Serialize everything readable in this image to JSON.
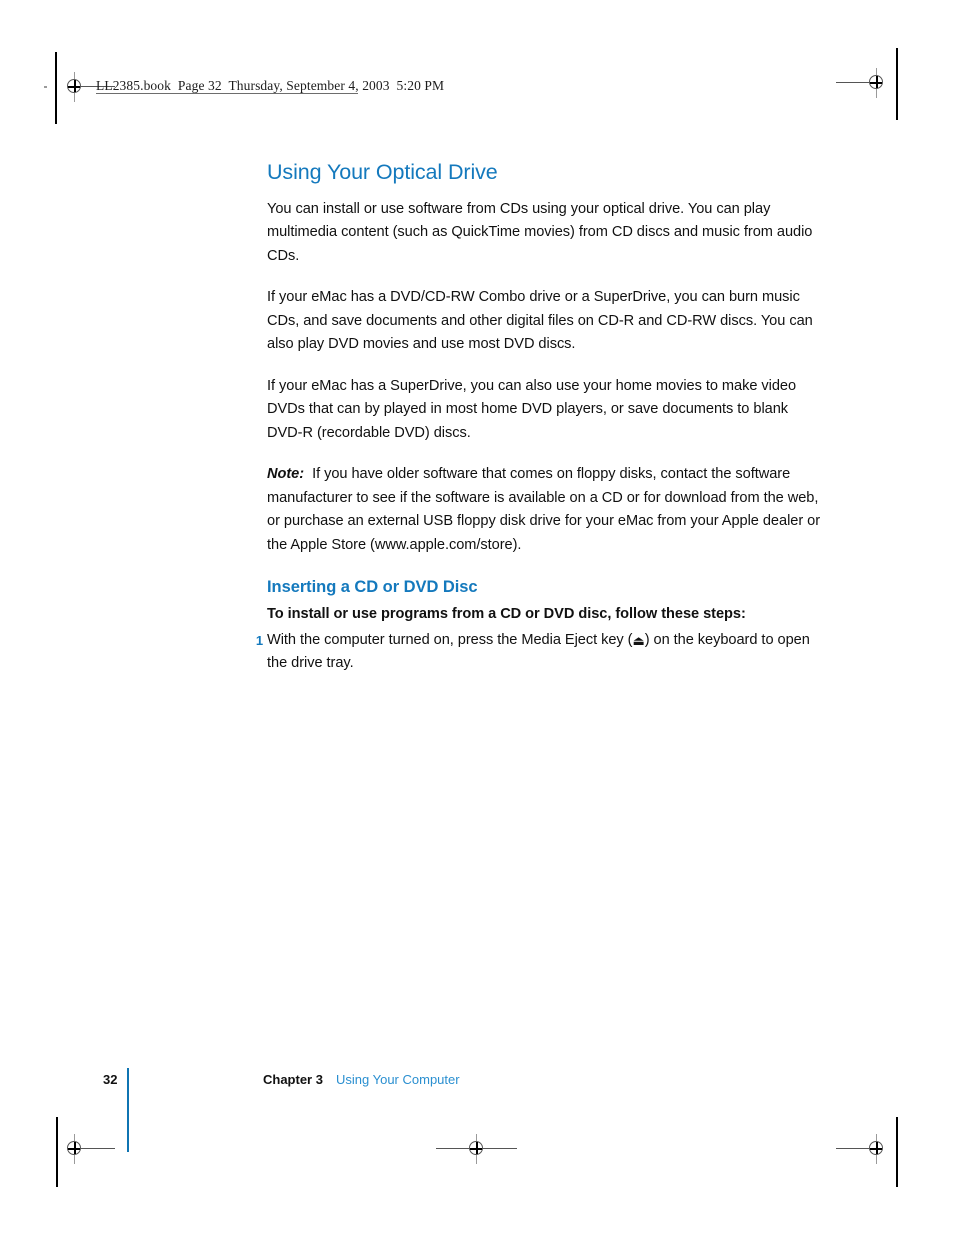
{
  "page": {
    "slug": "LL2385.book  Page 32  Thursday, September 4, 2003  5:20 PM",
    "accent_blue": "#1479bd",
    "link_blue": "#2a8fd0",
    "rule_blue": "#0f74b2"
  },
  "content": {
    "section_title": "Using Your Optical Drive",
    "paragraphs": [
      "You can install or use software from CDs using your optical drive. You can play multimedia content (such as QuickTime movies) from CD discs and music from audio CDs.",
      "If your eMac has a DVD/CD-RW Combo drive or a SuperDrive, you can burn music CDs, and save documents and other digital files on CD-R and CD-RW discs. You can also play DVD movies and use most DVD discs.",
      "If your eMac has a SuperDrive, you can also use your home movies to make video DVDs that can by played in most home DVD players, or save documents to blank DVD-R (recordable DVD) discs."
    ],
    "note": {
      "label": "Note:",
      "text": "If you have older software that comes on floppy disks, contact the software manufacturer to see if the software is available on a CD or for download from the web, or purchase an external USB floppy disk drive for your eMac from your Apple dealer or the Apple Store (www.apple.com/store)."
    },
    "sub_title": "Inserting a CD or DVD Disc",
    "lead_in": "To install or use programs from a CD or DVD disc, follow these steps:",
    "steps": [
      {
        "number": "1",
        "text_before": "With the computer turned on, press the Media Eject key (",
        "icon": "⏏",
        "text_after": ") on the keyboard to open the drive tray."
      }
    ]
  },
  "footer": {
    "folio": "32",
    "chapter": "Chapter 3",
    "chapter_title": "Using Your Computer"
  }
}
